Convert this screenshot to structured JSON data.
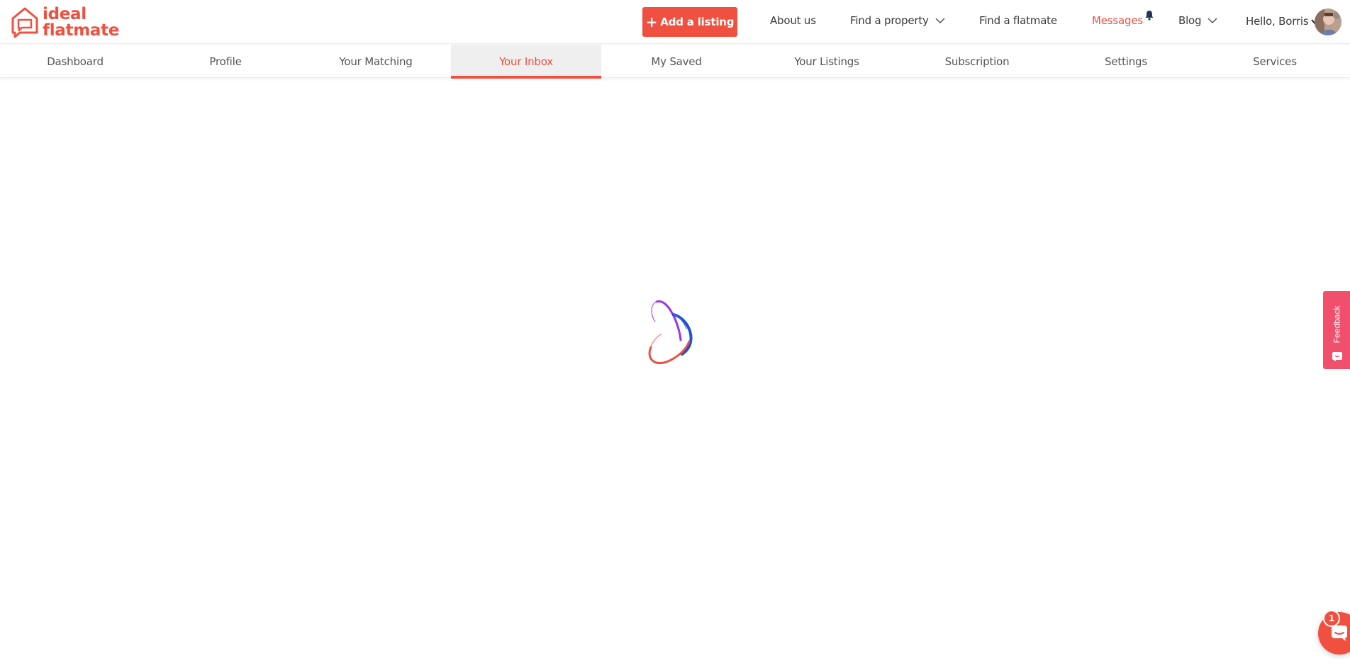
{
  "brand": {
    "line1": "ideal",
    "line2": "flatmate",
    "color": "#f0503f"
  },
  "header": {
    "add_listing": "Add a listing",
    "about": "About us",
    "find_property": "Find a property",
    "find_flatmate": "Find a flatmate",
    "messages": "Messages",
    "blog": "Blog",
    "greeting": "Hello, Borris"
  },
  "tabs": [
    {
      "label": "Dashboard"
    },
    {
      "label": "Profile"
    },
    {
      "label": "Your Matching"
    },
    {
      "label": "Your Inbox",
      "active": true
    },
    {
      "label": "My Saved"
    },
    {
      "label": "Your Listings"
    },
    {
      "label": "Subscription"
    },
    {
      "label": "Settings"
    },
    {
      "label": "Services"
    }
  ],
  "feedback": {
    "label": "Feedback"
  },
  "chat": {
    "badge": "1"
  },
  "icons": {
    "logo": "house-chat-logo-icon",
    "bell": "bell-icon",
    "chevron": "chevron-down-icon",
    "chat": "chat-icon",
    "spinner": "loading-spinner-icon"
  },
  "colors": {
    "accent": "#f0503f",
    "feedback": "#f0506b",
    "tab_active_bg": "#efefef"
  }
}
